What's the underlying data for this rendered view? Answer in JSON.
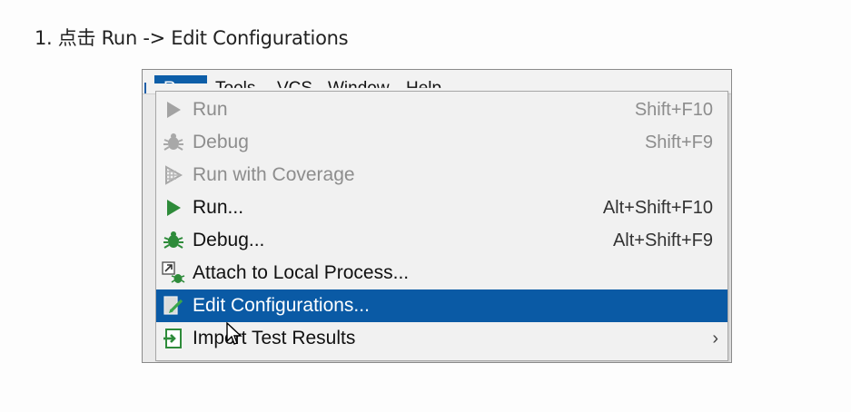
{
  "instruction": {
    "text": "1. 点击 Run -> Edit Configurations"
  },
  "menubar": {
    "items": [
      {
        "label": "Run"
      },
      {
        "label": "Tools"
      },
      {
        "label": "VCS"
      },
      {
        "label": "Window"
      },
      {
        "label": "Help"
      }
    ]
  },
  "menu": {
    "items": [
      {
        "label": "Run",
        "shortcut": "Shift+F10",
        "icon": "play-icon",
        "enabled": false
      },
      {
        "label": "Debug",
        "shortcut": "Shift+F9",
        "icon": "bug-icon",
        "enabled": false
      },
      {
        "label": "Run with Coverage",
        "shortcut": "",
        "icon": "coverage-icon",
        "enabled": false
      },
      {
        "label": "Run...",
        "shortcut": "Alt+Shift+F10",
        "icon": "play-icon",
        "enabled": true
      },
      {
        "label": "Debug...",
        "shortcut": "Alt+Shift+F9",
        "icon": "bug-icon",
        "enabled": true
      },
      {
        "label": "Attach to Local Process...",
        "shortcut": "",
        "icon": "attach-process-icon",
        "enabled": true
      },
      {
        "label": "Edit Configurations...",
        "shortcut": "",
        "icon": "edit-config-icon",
        "enabled": true,
        "selected": true
      },
      {
        "label": "Import Test Results",
        "shortcut": "",
        "icon": "import-icon",
        "enabled": true,
        "submenu": true
      }
    ],
    "submenu_arrow": "›"
  },
  "colors": {
    "selection": "#0a5aa5",
    "run_green": "#2e8b3a",
    "disabled_text": "#8d8d8d"
  }
}
